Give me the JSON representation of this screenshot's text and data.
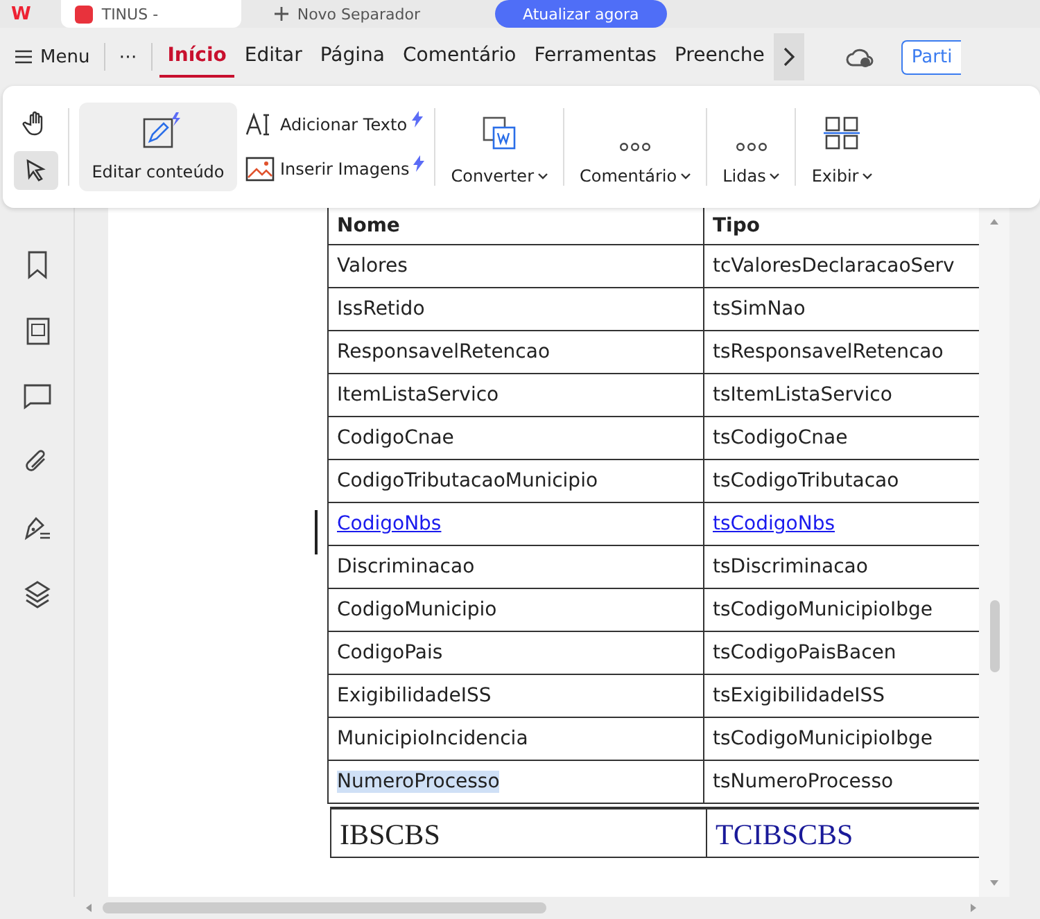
{
  "top_bar": {
    "app_logo": "W",
    "doc_tab": "TINUS -",
    "new_tab": "Novo Separador",
    "update_button": "Atualizar agora"
  },
  "menu": {
    "label": "Menu",
    "more": "⋯",
    "tabs": [
      {
        "label": "Início",
        "selected": true
      },
      {
        "label": "Editar",
        "selected": false
      },
      {
        "label": "Página",
        "selected": false
      },
      {
        "label": "Comentário",
        "selected": false
      },
      {
        "label": "Ferramentas",
        "selected": false
      },
      {
        "label": "Preenche",
        "selected": false
      }
    ],
    "share_button": "Parti"
  },
  "ribbon": {
    "tools": [
      {
        "kind": "hand",
        "selected": false
      },
      {
        "kind": "select",
        "selected": true
      }
    ],
    "edit_content": {
      "label": "Editar conteúdo",
      "selected": true
    },
    "small_buttons": [
      {
        "kind": "text",
        "label": "Adicionar Texto"
      },
      {
        "kind": "image",
        "label": "Inserir Imagens"
      }
    ],
    "dropdowns": [
      {
        "kind": "convert",
        "label": "Converter"
      },
      {
        "kind": "dots",
        "label": "Comentário"
      },
      {
        "kind": "dots",
        "label": "Lidas"
      },
      {
        "kind": "grid",
        "label": "Exibir"
      }
    ]
  },
  "table": {
    "columns": [
      "Nome",
      "Tipo"
    ],
    "rows": [
      {
        "nome": "Valores",
        "tipo": "tcValoresDeclaracaoServ",
        "link": false,
        "highlighted": false
      },
      {
        "nome": "IssRetido",
        "tipo": "tsSimNao",
        "link": false,
        "highlighted": false
      },
      {
        "nome": "ResponsavelRetencao",
        "tipo": "tsResponsavelRetencao",
        "link": false,
        "highlighted": false
      },
      {
        "nome": "ItemListaServico",
        "tipo": "tsItemListaServico",
        "link": false,
        "highlighted": false
      },
      {
        "nome": "CodigoCnae",
        "tipo": "tsCodigoCnae",
        "link": false,
        "highlighted": false
      },
      {
        "nome": "CodigoTributacaoMunicipio",
        "tipo": "tsCodigoTributacao",
        "link": false,
        "highlighted": false
      },
      {
        "nome": "CodigoNbs",
        "tipo": "tsCodigoNbs",
        "link": true,
        "highlighted": false
      },
      {
        "nome": "Discriminacao",
        "tipo": "tsDiscriminacao",
        "link": false,
        "highlighted": false
      },
      {
        "nome": "CodigoMunicipio",
        "tipo": "tsCodigoMunicipioIbge",
        "link": false,
        "highlighted": false
      },
      {
        "nome": "CodigoPais",
        "tipo": "tsCodigoPaisBacen",
        "link": false,
        "highlighted": false
      },
      {
        "nome": "ExigibilidadeISS",
        "tipo": "tsExigibilidadeISS",
        "link": false,
        "highlighted": false
      },
      {
        "nome": "MunicipioIncidencia",
        "tipo": "tsCodigoMunicipioIbge",
        "link": false,
        "highlighted": false
      },
      {
        "nome": "NumeroProcesso",
        "tipo": "tsNumeroProcesso",
        "link": false,
        "highlighted": true
      }
    ]
  },
  "next_table": {
    "nome": "IBSCBS",
    "tipo": "TCIBSCBS"
  }
}
